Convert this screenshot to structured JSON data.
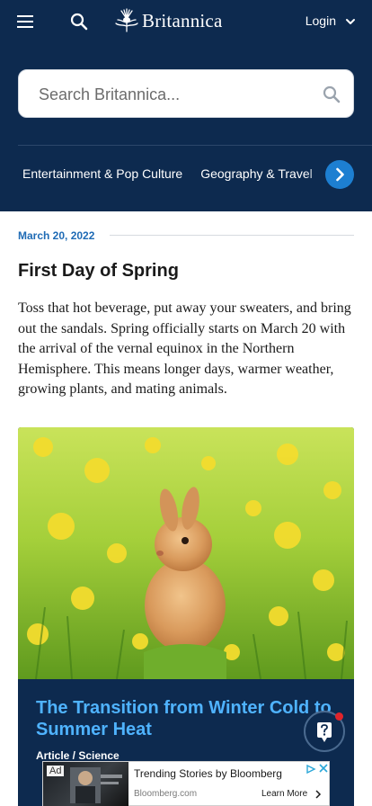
{
  "header": {
    "logo_text": "Britannica",
    "login_label": "Login"
  },
  "search": {
    "placeholder": "Search Britannica..."
  },
  "categories": [
    {
      "label": "Entertainment & Pop Culture"
    },
    {
      "label": "Geography & Travel"
    }
  ],
  "article": {
    "date": "March 20, 2022",
    "title": "First Day of Spring",
    "body": "Toss that hot beverage, put away your sweaters, and bring out the sandals. Spring officially starts on March 20 with the arrival of the vernal equinox in the Northern Hemisphere. This means longer days, warmer weather, growing plants, and mating animals."
  },
  "card": {
    "title": "The Transition from Winter Cold to Summer Heat",
    "meta": "Article / Science"
  },
  "ad": {
    "badge": "Ad",
    "headline": "Trending Stories by Bloomberg",
    "source": "Bloomberg.com",
    "cta": "Learn More"
  },
  "colors": {
    "brand_navy": "#0d2a4f",
    "accent_blue": "#1d7fd1",
    "link_blue": "#4fb3ff",
    "date_blue": "#1f6bb5"
  },
  "icons": [
    "menu-icon",
    "search-icon",
    "thistle-logo-icon",
    "chevron-down-icon",
    "chevron-right-icon",
    "question-icon",
    "close-icon",
    "ad-choices-icon"
  ]
}
